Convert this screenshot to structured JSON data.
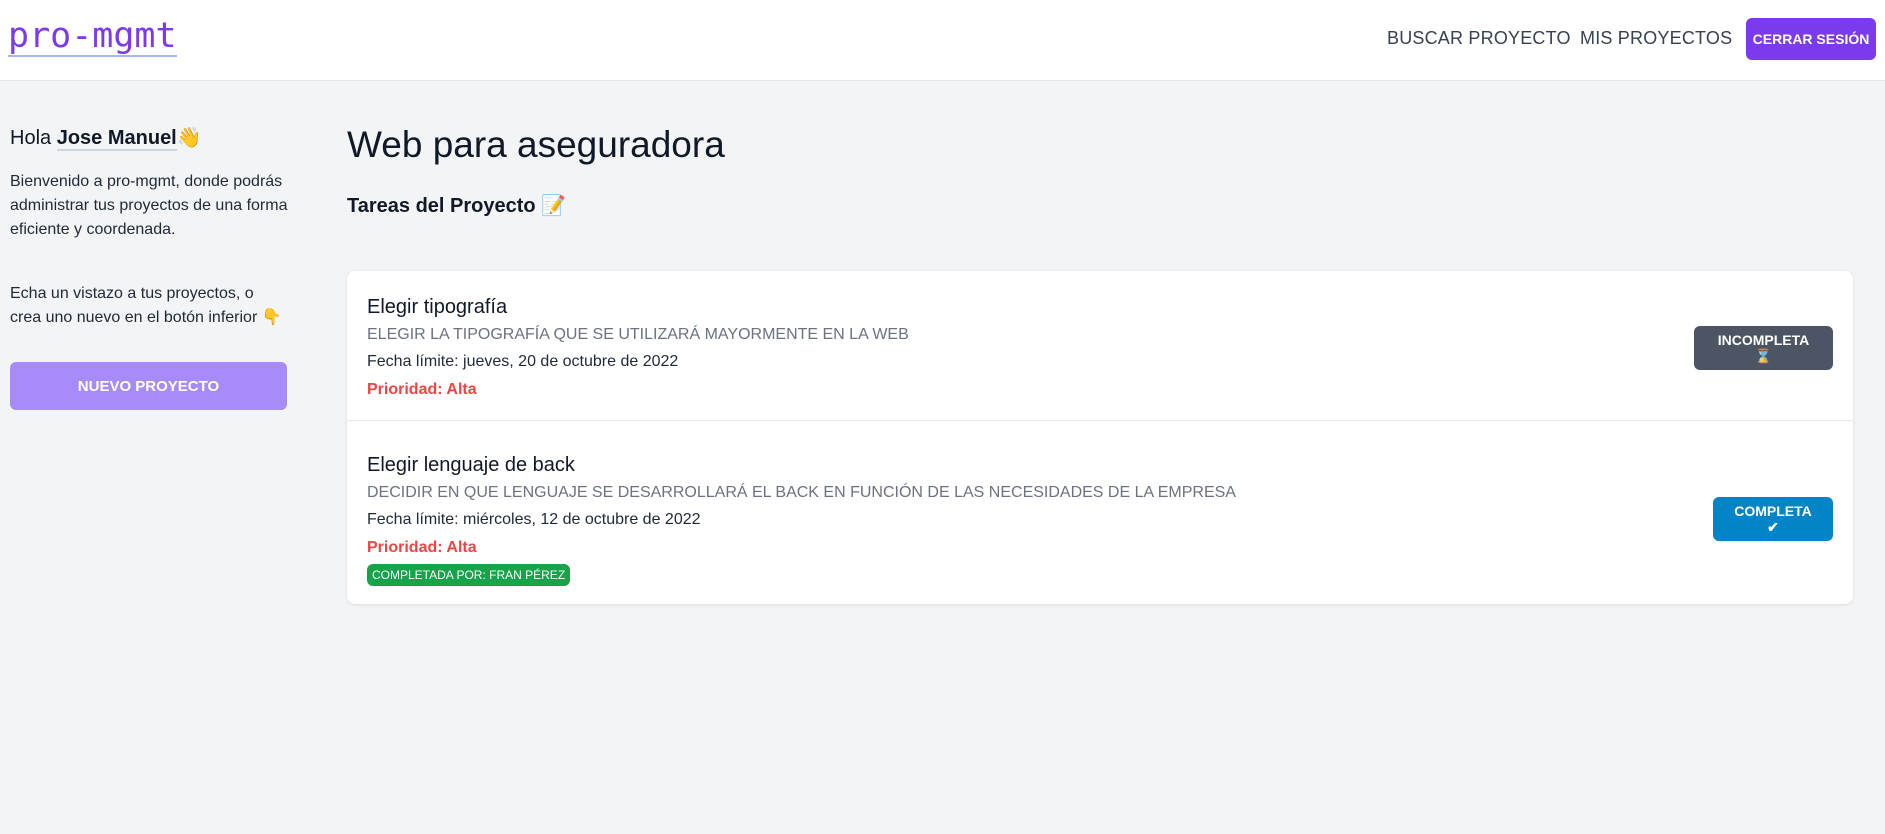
{
  "header": {
    "logo": "pro-mgmt",
    "nav": {
      "search": "BUSCAR PROYECTO",
      "mine": "MIS PROYECTOS"
    },
    "logout_label": "CERRAR SESIÓN",
    "brand_color": "#7c3aed"
  },
  "sidebar": {
    "greeting_prefix": "Hola ",
    "user_name": "Jose Manuel",
    "greeting_emoji": "👋",
    "intro": "Bienvenido a pro-mgmt, donde podrás administrar tus proyectos de una forma eficiente y coordenada.",
    "hint": "Echa un vistazo a tus proyectos, o crea uno nuevo en el botón inferior 👇",
    "new_project_label": "NUEVO PROYECTO"
  },
  "main": {
    "project_title": "Web para aseguradora",
    "tasks_title": "Tareas del Proyecto 📝",
    "tasks": [
      {
        "name": "Elegir tipografía",
        "description": "ELEGIR LA TIPOGRAFÍA QUE SE UTILIZARÁ MAYORMENTE EN LA WEB",
        "due": "Fecha límite: jueves, 20 de octubre de 2022",
        "priority": "Prioridad: Alta",
        "status_label": "INCOMPLETA ⌛",
        "status_color": "#4b5563"
      },
      {
        "name": "Elegir lenguaje de back",
        "description": "DECIDIR EN QUE LENGUAJE SE DESARROLLARÁ EL BACK EN FUNCIÓN DE LAS NECESIDADES DE LA EMPRESA",
        "due": "Fecha límite: miércoles, 12 de octubre de 2022",
        "priority": "Prioridad: Alta",
        "completed_by": "COMPLETADA POR: FRAN PÉREZ",
        "status_label": "COMPLETA ✔",
        "status_color": "#0284c7"
      }
    ]
  }
}
